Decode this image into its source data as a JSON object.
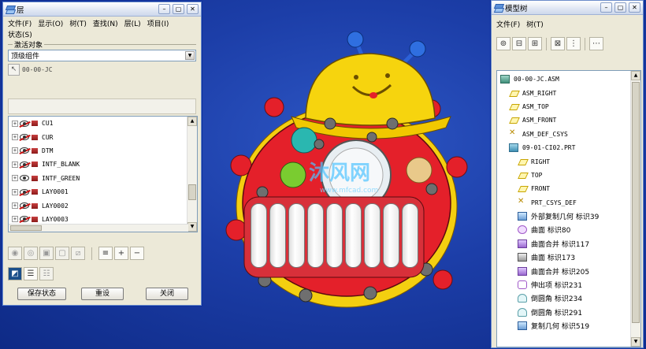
{
  "layers_window": {
    "title": "层",
    "menu": [
      "文件(F)",
      "显示(O)",
      "树(T)",
      "查找(N)",
      "层(L)",
      "项目(I)",
      "状态(S)"
    ],
    "active_object_label": "激活对象",
    "active_object_value": "顶级组件",
    "current_object": "00-00-JC",
    "layers": [
      {
        "name": "CU1",
        "visible": false
      },
      {
        "name": "CUR",
        "visible": false
      },
      {
        "name": "DTM",
        "visible": false
      },
      {
        "name": "INTF_BLANK",
        "visible": false
      },
      {
        "name": "INTF_GREEN",
        "visible": true
      },
      {
        "name": "LAY0001",
        "visible": false
      },
      {
        "name": "LAY0002",
        "visible": false
      },
      {
        "name": "LAY0003",
        "visible": false
      }
    ],
    "buttons": {
      "save_state": "保存状态",
      "reset": "重设",
      "close": "关闭"
    }
  },
  "model_tree_window": {
    "title": "模型树",
    "menu": [
      "文件(F)",
      "树(T)"
    ],
    "items": [
      {
        "label": "00-00-JC.ASM",
        "icon": "assembly-icon",
        "indent": 0
      },
      {
        "label": "ASM_RIGHT",
        "icon": "datum-plane-icon",
        "indent": 1
      },
      {
        "label": "ASM_TOP",
        "icon": "datum-plane-icon",
        "indent": 1
      },
      {
        "label": "ASM_FRONT",
        "icon": "datum-plane-icon",
        "indent": 1
      },
      {
        "label": "ASM_DEF_CSYS",
        "icon": "csys-icon",
        "indent": 1
      },
      {
        "label": "09-01-CI02.PRT",
        "icon": "part-icon",
        "indent": 1
      },
      {
        "label": "RIGHT",
        "icon": "datum-plane-icon",
        "indent": 2
      },
      {
        "label": "TOP",
        "icon": "datum-plane-icon",
        "indent": 2
      },
      {
        "label": "FRONT",
        "icon": "datum-plane-icon",
        "indent": 2
      },
      {
        "label": "PRT_CSYS_DEF",
        "icon": "csys-icon",
        "indent": 2
      },
      {
        "label": "外部复制几何 标识39",
        "icon": "copy-geometry-icon",
        "indent": 2
      },
      {
        "label": "曲面 标识80",
        "icon": "surface-icon",
        "indent": 2
      },
      {
        "label": "曲面合并 标识117",
        "icon": "merge-icon",
        "indent": 2
      },
      {
        "label": "曲面 标识173",
        "icon": "surface2-icon",
        "indent": 2
      },
      {
        "label": "曲面合并 标识205",
        "icon": "merge-icon",
        "indent": 2
      },
      {
        "label": "伸出项 标识231",
        "icon": "extrude-icon",
        "indent": 2
      },
      {
        "label": "倒圆角 标识234",
        "icon": "round-icon",
        "indent": 2
      },
      {
        "label": "倒圆角 标识291",
        "icon": "round-icon",
        "indent": 2
      },
      {
        "label": "复制几何 标识519",
        "icon": "copy-geometry-icon",
        "indent": 2
      }
    ]
  },
  "watermark": {
    "main": "沐风网",
    "sub": "www.mfcad.com"
  },
  "colors": {
    "viewport": "#1c3ea8",
    "body_red": "#e4202a",
    "cap_yellow": "#f6d40e",
    "antenna_blue": "#2f6fe0"
  }
}
